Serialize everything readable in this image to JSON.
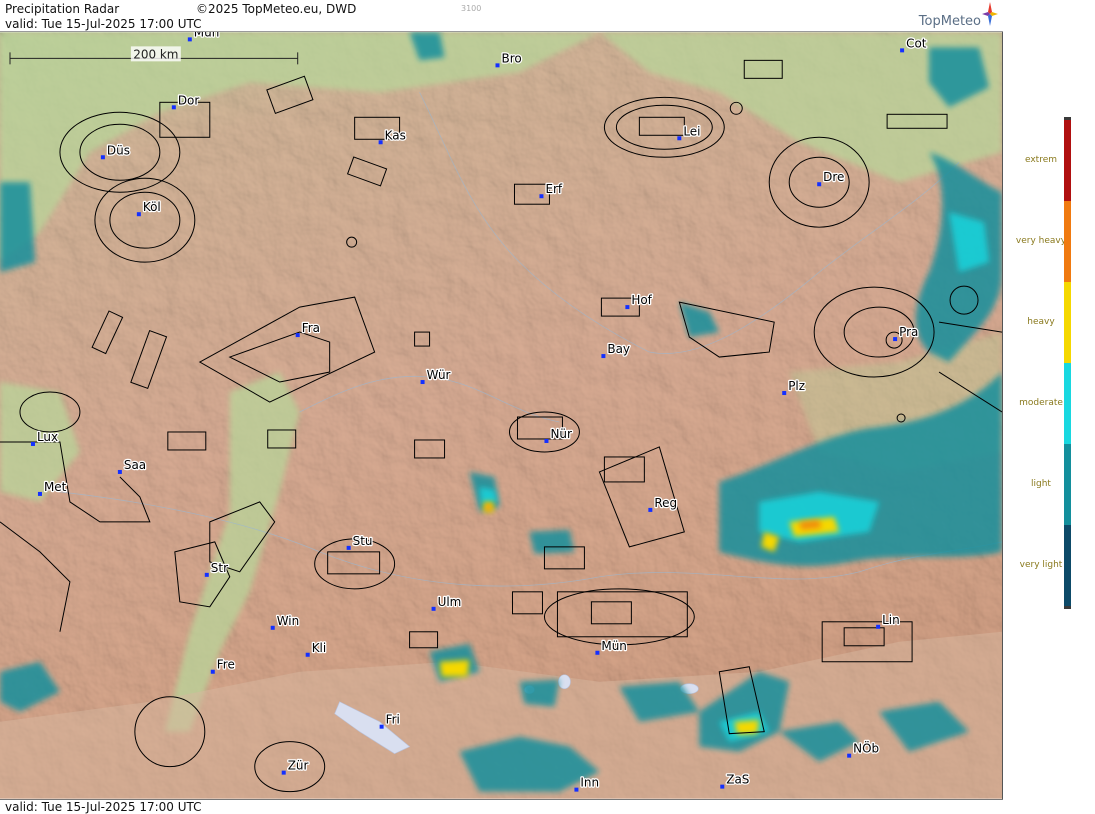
{
  "header": {
    "title": "Precipitation Radar",
    "copyright": "©2025 TopMeteo.eu, DWD",
    "valid": "valid:  Tue  15-Jul-2025 17:00 UTC",
    "code": "3100",
    "logo_text": "TopMeteo"
  },
  "footer": {
    "valid": "valid:  Tue  15-Jul-2025 17:00 UTC"
  },
  "map": {
    "scale_label": "200 km",
    "cities": [
      {
        "name": "Mün",
        "kind": "top-cut"
      },
      {
        "name": "Bro"
      },
      {
        "name": "Cot"
      },
      {
        "name": "Dor"
      },
      {
        "name": "Kas"
      },
      {
        "name": "Lei"
      },
      {
        "name": "Düs"
      },
      {
        "name": "Erf"
      },
      {
        "name": "Dre"
      },
      {
        "name": "Köl"
      },
      {
        "name": "Hof"
      },
      {
        "name": "Fra"
      },
      {
        "name": "Pra"
      },
      {
        "name": "Bay"
      },
      {
        "name": "Wür"
      },
      {
        "name": "Plz"
      },
      {
        "name": "Lux"
      },
      {
        "name": "Nür"
      },
      {
        "name": "Saa"
      },
      {
        "name": "Met"
      },
      {
        "name": "Reg"
      },
      {
        "name": "Stu"
      },
      {
        "name": "Str"
      },
      {
        "name": "Ulm"
      },
      {
        "name": "Win"
      },
      {
        "name": "Mün"
      },
      {
        "name": "Kli"
      },
      {
        "name": "Lin"
      },
      {
        "name": "Fre"
      },
      {
        "name": "Fri"
      },
      {
        "name": "NÖb"
      },
      {
        "name": "Zür"
      },
      {
        "name": "Inn"
      },
      {
        "name": "ZaS"
      }
    ]
  },
  "legend": {
    "levels": [
      {
        "label": "extrem",
        "color": "#b01010"
      },
      {
        "label": "very heavy",
        "color": "#f07a10"
      },
      {
        "label": "heavy",
        "color": "#f5d800"
      },
      {
        "label": "moderate",
        "color": "#18d8e0"
      },
      {
        "label": "light",
        "color": "#138f9c"
      },
      {
        "label": "very light",
        "color": "#0d4a68"
      }
    ]
  },
  "colors": {
    "terrain_low": "#cfe0b0",
    "terrain_high": "#e8b49c",
    "precip_very_light": "#0d4a68",
    "precip_light": "#138f9c",
    "precip_moderate": "#18d8e0",
    "precip_heavy": "#f5d800",
    "precip_very_heavy": "#f07a10",
    "city_marker": "#1430ff"
  }
}
